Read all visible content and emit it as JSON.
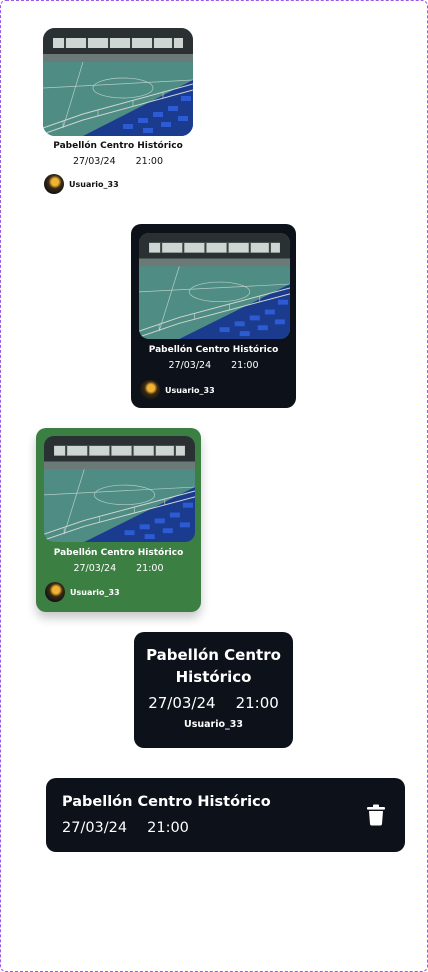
{
  "event": {
    "venue": "Pabellón Centro Histórico",
    "venue_line1": "Pabellón Centro",
    "venue_line2": "Histórico",
    "date": "27/03/24",
    "time": "21:00",
    "user": "Usuario_33"
  },
  "icons": {
    "delete": "trash-icon",
    "avatar": "user-avatar"
  },
  "colors": {
    "dark_card": "#0c111a",
    "selected_card": "#3b7f42",
    "frame_border": "#9b59e8"
  }
}
